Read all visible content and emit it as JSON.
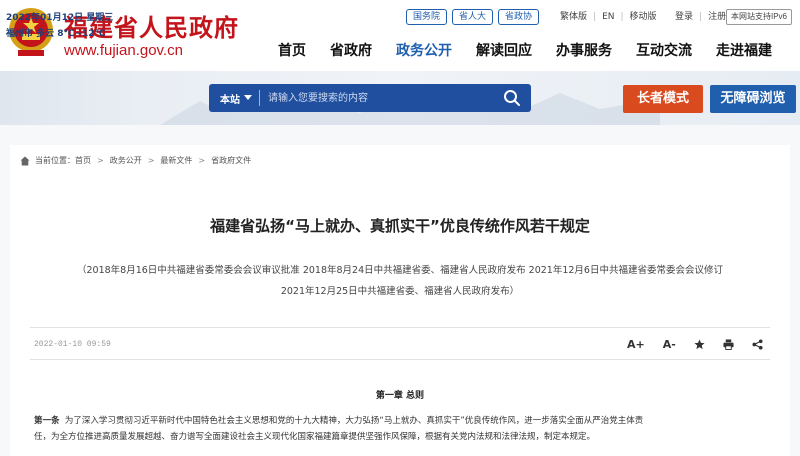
{
  "header": {
    "site_name": "福建省人民政府",
    "site_url": "www.fujian.gov.cn",
    "top_pills": [
      "国务院",
      "省人大",
      "省政协"
    ],
    "top_links": [
      "繁体版",
      "EN",
      "移动版"
    ],
    "user_links": [
      "登录",
      "注册"
    ],
    "ipv6_badge": "本网站支持IPv6",
    "nav": [
      "首页",
      "省政府",
      "政务公开",
      "解读回应",
      "办事服务",
      "互动交流",
      "走进福建"
    ],
    "active_nav": "政务公开"
  },
  "banner": {
    "date_line": "2022年01月12日 星期三",
    "weather_line": "福州市 多云 8℃~12℃",
    "search_scope": "本站",
    "search_placeholder": "请输入您要搜索的内容",
    "elder_mode": "长者模式",
    "accessible": "无障碍浏览"
  },
  "breadcrumb": {
    "label": "当前位置：",
    "items": [
      "首页",
      "政务公开",
      "最新文件",
      "省政府文件"
    ]
  },
  "article": {
    "title": "福建省弘扬“马上就办、真抓实干”优良传统作风若干规定",
    "meta_line1": "（2018年8月16日中共福建省委常委会会议审议批准  2018年8月24日中共福建省委、福建省人民政府发布  2021年12月6日中共福建省委常委会会议修订",
    "meta_line2": "2021年12月25日中共福建省委、福建省人民政府发布）",
    "date": "2022-01-10 09:59",
    "tools": [
      "A+",
      "A-"
    ],
    "chapter": "第一章  总则",
    "para_label": "第一条",
    "para_line1": "为了深入学习贯彻习近平新时代中国特色社会主义思想和党的十九大精神，大力弘扬“马上就办、真抓实干”优良传统作风，进一步落实全面从严治党主体责",
    "para_line2": "任，为全方位推进高质量发展超越、奋力谱写全面建设社会主义现代化国家福建篇章提供坚强作风保障，根据有关党内法规和法律法规，制定本规定。"
  },
  "colors": {
    "brand_red": "#c4141b",
    "nav_blue": "#1f5fae",
    "elder_orange": "#d94b1f"
  }
}
